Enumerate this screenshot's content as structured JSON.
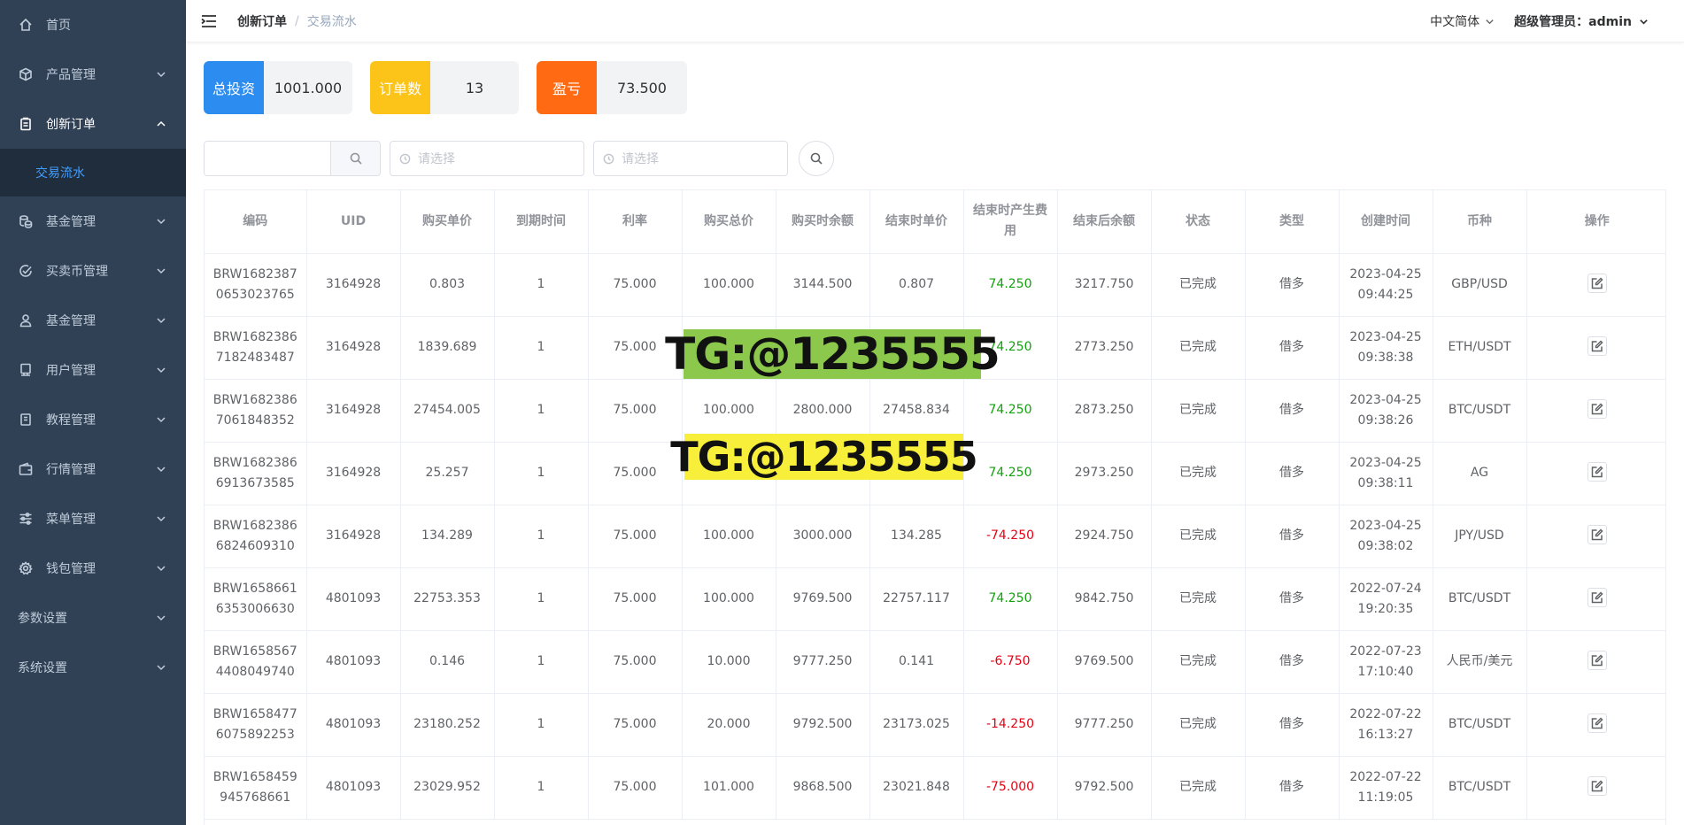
{
  "sidebar": {
    "items": [
      {
        "label": "首页",
        "icon": "home-icon",
        "expandable": false
      },
      {
        "label": "产品管理",
        "icon": "box-icon",
        "expandable": true
      },
      {
        "label": "创新订单",
        "icon": "clipboard-icon",
        "expandable": true,
        "expanded": true
      },
      {
        "label": "交易流水",
        "sub": true,
        "active": true
      },
      {
        "label": "基金管理",
        "icon": "coins-icon",
        "expandable": true
      },
      {
        "label": "买卖币管理",
        "icon": "check-circle-icon",
        "expandable": true
      },
      {
        "label": "基金管理",
        "icon": "user-icon",
        "expandable": true
      },
      {
        "label": "用户管理",
        "icon": "monitor-icon",
        "expandable": true
      },
      {
        "label": "教程管理",
        "icon": "book-icon",
        "expandable": true
      },
      {
        "label": "行情管理",
        "icon": "wallet-icon",
        "expandable": true
      },
      {
        "label": "菜单管理",
        "icon": "sliders-icon",
        "expandable": true
      },
      {
        "label": "钱包管理",
        "icon": "gear-icon",
        "expandable": true
      },
      {
        "label": "参数设置",
        "icon": null,
        "expandable": true
      },
      {
        "label": "系统设置",
        "icon": null,
        "expandable": true
      }
    ]
  },
  "header": {
    "breadcrumb": [
      "创新订单",
      "交易流水"
    ],
    "separator": "/",
    "language": "中文简体",
    "user": "超级管理员：admin"
  },
  "stats": [
    {
      "label": "总投资",
      "value": "1001.000",
      "color": "#2d8cf0"
    },
    {
      "label": "订单数",
      "value": "13",
      "color": "#fcc419"
    },
    {
      "label": "盈亏",
      "value": "73.500",
      "color": "#ff6a13"
    }
  ],
  "filters": {
    "search_value": "",
    "date_start_placeholder": "请选择",
    "date_end_placeholder": "请选择"
  },
  "table": {
    "columns": [
      "编码",
      "UID",
      "购买单价",
      "到期时间",
      "利率",
      "购买总价",
      "购买时余额",
      "结束时单价",
      "结束时产生费用",
      "结束后余额",
      "状态",
      "类型",
      "创建时间",
      "币种",
      "操作"
    ],
    "rows": [
      {
        "code": "BRW16823870653023765",
        "uid": "3164928",
        "buy_price": "0.803",
        "expire": "1",
        "rate": "75.000",
        "total": "100.000",
        "balance_before": "3144.500",
        "end_price": "0.807",
        "fee": "74.250",
        "fee_sign": "pos",
        "balance_after": "3217.750",
        "status": "已完成",
        "type": "借多",
        "created": "2023-04-25 09:44:25",
        "currency": "GBP/USD"
      },
      {
        "code": "BRW16823867182483487",
        "uid": "3164928",
        "buy_price": "1839.689",
        "expire": "1",
        "rate": "75.000",
        "total": "",
        "balance_before": "",
        "end_price": "",
        "fee": "74.250",
        "fee_sign": "pos",
        "balance_after": "2773.250",
        "status": "已完成",
        "type": "借多",
        "created": "2023-04-25 09:38:38",
        "currency": "ETH/USDT"
      },
      {
        "code": "BRW16823867061848352",
        "uid": "3164928",
        "buy_price": "27454.005",
        "expire": "1",
        "rate": "75.000",
        "total": "100.000",
        "balance_before": "2800.000",
        "end_price": "27458.834",
        "fee": "74.250",
        "fee_sign": "pos",
        "balance_after": "2873.250",
        "status": "已完成",
        "type": "借多",
        "created": "2023-04-25 09:38:26",
        "currency": "BTC/USDT"
      },
      {
        "code": "BRW16823866913673585",
        "uid": "3164928",
        "buy_price": "25.257",
        "expire": "1",
        "rate": "75.000",
        "total": "",
        "balance_before": "",
        "end_price": "",
        "fee": "74.250",
        "fee_sign": "pos",
        "balance_after": "2973.250",
        "status": "已完成",
        "type": "借多",
        "created": "2023-04-25 09:38:11",
        "currency": "AG"
      },
      {
        "code": "BRW16823866824609310",
        "uid": "3164928",
        "buy_price": "134.289",
        "expire": "1",
        "rate": "75.000",
        "total": "100.000",
        "balance_before": "3000.000",
        "end_price": "134.285",
        "fee": "-74.250",
        "fee_sign": "neg",
        "balance_after": "2924.750",
        "status": "已完成",
        "type": "借多",
        "created": "2023-04-25 09:38:02",
        "currency": "JPY/USD"
      },
      {
        "code": "BRW16586616353006630",
        "uid": "4801093",
        "buy_price": "22753.353",
        "expire": "1",
        "rate": "75.000",
        "total": "100.000",
        "balance_before": "9769.500",
        "end_price": "22757.117",
        "fee": "74.250",
        "fee_sign": "pos",
        "balance_after": "9842.750",
        "status": "已完成",
        "type": "借多",
        "created": "2022-07-24 19:20:35",
        "currency": "BTC/USDT"
      },
      {
        "code": "BRW16585674408049740",
        "uid": "4801093",
        "buy_price": "0.146",
        "expire": "1",
        "rate": "75.000",
        "total": "10.000",
        "balance_before": "9777.250",
        "end_price": "0.141",
        "fee": "-6.750",
        "fee_sign": "neg",
        "balance_after": "9769.500",
        "status": "已完成",
        "type": "借多",
        "created": "2022-07-23 17:10:40",
        "currency": "人民币/美元"
      },
      {
        "code": "BRW16584776075892253",
        "uid": "4801093",
        "buy_price": "23180.252",
        "expire": "1",
        "rate": "75.000",
        "total": "20.000",
        "balance_before": "9792.500",
        "end_price": "23173.025",
        "fee": "-14.250",
        "fee_sign": "neg",
        "balance_after": "9777.250",
        "status": "已完成",
        "type": "借多",
        "created": "2022-07-22 16:13:27",
        "currency": "BTC/USDT"
      },
      {
        "code": "BRW1658459945768661",
        "uid": "4801093",
        "buy_price": "23029.952",
        "expire": "1",
        "rate": "75.000",
        "total": "101.000",
        "balance_before": "9868.500",
        "end_price": "23021.848",
        "fee": "-75.000",
        "fee_sign": "neg",
        "balance_after": "9792.500",
        "status": "已完成",
        "type": "借多",
        "created": "2022-07-22 11:19:05",
        "currency": "BTC/USDT"
      }
    ]
  },
  "watermarks": [
    "TG:@1235555",
    "TG:@1235555"
  ]
}
